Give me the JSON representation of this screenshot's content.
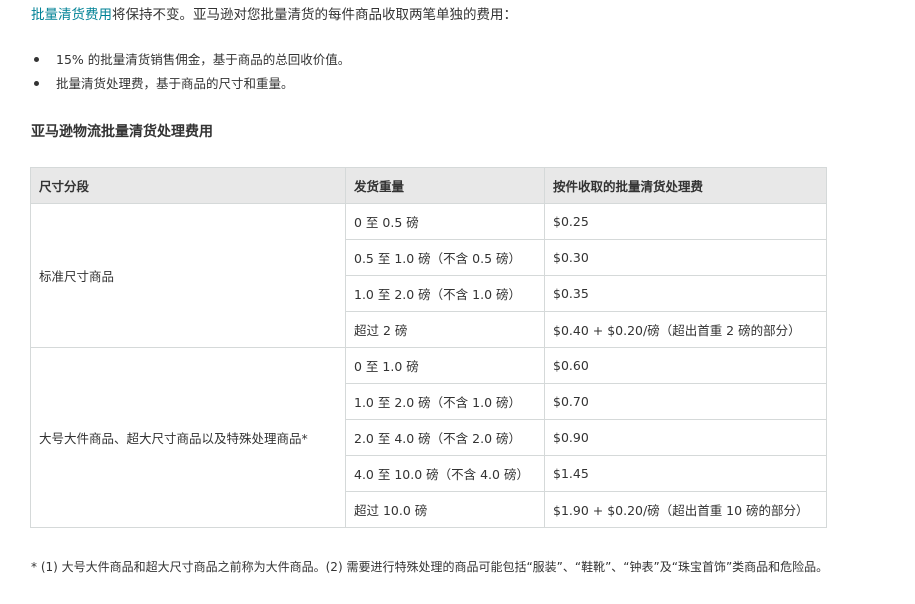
{
  "intro": {
    "link_text": "批量清货费用",
    "text": "将保持不变。亚马逊对您批量清货的每件商品收取两笔单独的费用："
  },
  "bullets": [
    "15% 的批量清货销售佣金，基于商品的总回收价值。",
    "批量清货处理费，基于商品的尺寸和重量。"
  ],
  "section_title": "亚马逊物流批量清货处理费用",
  "table": {
    "headers": [
      "尺寸分段",
      "发货重量",
      "按件收取的批量清货处理费"
    ],
    "groups": [
      {
        "tier": "标准尺寸商品",
        "rows": [
          {
            "weight": "0 至 0.5 磅",
            "fee": "$0.25"
          },
          {
            "weight": "0.5 至 1.0 磅（不含 0.5 磅）",
            "fee": "$0.30"
          },
          {
            "weight": "1.0 至 2.0 磅（不含 1.0 磅）",
            "fee": "$0.35"
          },
          {
            "weight": "超过 2 磅",
            "fee": "$0.40 + $0.20/磅（超出首重 2 磅的部分）"
          }
        ]
      },
      {
        "tier": "大号大件商品、超大尺寸商品以及特殊处理商品*",
        "rows": [
          {
            "weight": "0 至 1.0 磅",
            "fee": "$0.60"
          },
          {
            "weight": "1.0 至 2.0 磅（不含 1.0 磅）",
            "fee": "$0.70"
          },
          {
            "weight": "2.0 至 4.0 磅（不含 2.0 磅）",
            "fee": "$0.90"
          },
          {
            "weight": "4.0 至 10.0 磅（不含 4.0 磅）",
            "fee": "$1.45"
          },
          {
            "weight": "超过 10.0 磅",
            "fee": "$1.90 + $0.20/磅（超出首重 10 磅的部分）"
          }
        ]
      }
    ]
  },
  "footnote": "* (1) 大号大件商品和超大尺寸商品之前称为大件商品。(2) 需要进行特殊处理的商品可能包括“服装”、“鞋靴”、“钟表”及“珠宝首饰”类商品和危险品。",
  "colors": {
    "link": "#008296",
    "header_bg": "#e8e8e8",
    "border": "#d5d9d9",
    "text": "#333333"
  }
}
